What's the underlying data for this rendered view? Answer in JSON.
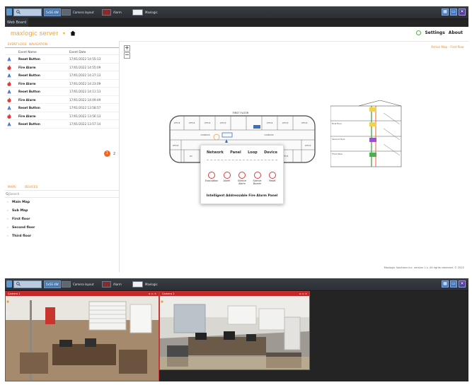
{
  "taskbar": {
    "search_label": "",
    "layout_btn": "5x5E 4W",
    "items": [
      {
        "label": "Camera layout",
        "icon": "camera-layout-thumb"
      },
      {
        "label": "Alarm",
        "icon": "alarm-thumb"
      },
      {
        "label": "Maxlogic",
        "icon": "map-thumb"
      }
    ],
    "right_buttons": [
      "▦",
      "▭",
      "✕"
    ]
  },
  "taskbar2": {
    "layout_btn": "5x5E 4W",
    "items": [
      {
        "label": "Camera layout"
      },
      {
        "label": "Alarm"
      },
      {
        "label": "Maxlogic"
      }
    ]
  },
  "window": {
    "tab_label": "Web Board"
  },
  "header": {
    "logo": "maxlogic server",
    "settings": "Settings",
    "about": "About"
  },
  "events": {
    "tabs": [
      "Event Logs",
      "Navigation"
    ],
    "columns": [
      "Event Name",
      "Event Date"
    ],
    "rows": [
      {
        "name": "Reset Button",
        "date": "17/01/2022 14:55:13",
        "kind": "reset"
      },
      {
        "name": "Fire Alarm",
        "date": "17/01/2022 14:55:09",
        "kind": "fire"
      },
      {
        "name": "Reset Button",
        "date": "17/01/2022 14:27:13",
        "kind": "reset"
      },
      {
        "name": "Fire Alarm",
        "date": "17/01/2022 14:23:09",
        "kind": "fire"
      },
      {
        "name": "Reset Button",
        "date": "17/01/2022 14:11:13",
        "kind": "reset"
      },
      {
        "name": "Fire Alarm",
        "date": "17/01/2022 14:09:49",
        "kind": "fire"
      },
      {
        "name": "Reset Button",
        "date": "17/01/2022 13:58:57",
        "kind": "reset"
      },
      {
        "name": "Fire Alarm",
        "date": "17/01/2022 13:56:13",
        "kind": "fire"
      },
      {
        "name": "Reset Button",
        "date": "17/01/2022 13:57:14",
        "kind": "reset"
      }
    ],
    "pager": {
      "current": "1",
      "next": "2"
    }
  },
  "maps": {
    "tabs": [
      "Maps",
      "Devices"
    ],
    "search_placeholder": "Search",
    "items": [
      "Main Map",
      "Sub Map",
      "First floor",
      "Second floor",
      "Third floor"
    ]
  },
  "map_view": {
    "breadcrumb": "Active Map - First floor",
    "zoom_in": "+",
    "zoom_out": "−",
    "footer": "Maxlogic Solutions Inc. version 1.x. All rights reserved. © 2022",
    "floor_label": "FIRST FLOOR",
    "section_labels": [
      "First floor",
      "Second floor",
      "Third floor"
    ],
    "room_labels": [
      "OFFICE",
      "CORRIDOR",
      "LOBBY",
      "WC"
    ]
  },
  "panel_popup": {
    "headers": [
      "Network",
      "Panel",
      "Loop",
      "Device"
    ],
    "buttons": [
      "Evacuation",
      "Alarm",
      "Silence Alarm",
      "Silence Buzzer",
      "Reset"
    ],
    "title": "Intelligent Addressable Fire Alarm Panel"
  },
  "cameras": [
    {
      "title": "Camera 1"
    },
    {
      "title": "Camera 2"
    }
  ],
  "colors": {
    "accent": "#f08a20",
    "alarm_red": "#e0383b",
    "reset_blue": "#3b6fc2",
    "ok_green": "#55b043"
  }
}
